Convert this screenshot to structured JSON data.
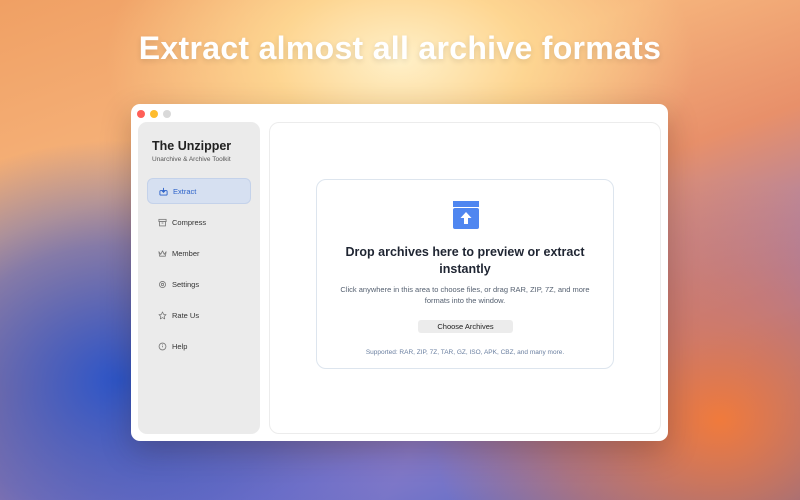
{
  "hero": {
    "title": "Extract almost all archive formats"
  },
  "app": {
    "title": "The Unzipper",
    "subtitle": "Unarchive & Archive Toolkit"
  },
  "sidebar": {
    "items": [
      {
        "label": "Extract",
        "icon": "extract-icon",
        "active": true
      },
      {
        "label": "Compress",
        "icon": "archive-box-icon",
        "active": false
      },
      {
        "label": "Member",
        "icon": "crown-icon",
        "active": false
      },
      {
        "label": "Settings",
        "icon": "gear-icon",
        "active": false
      },
      {
        "label": "Rate Us",
        "icon": "star-icon",
        "active": false
      },
      {
        "label": "Help",
        "icon": "help-icon",
        "active": false
      }
    ]
  },
  "dropzone": {
    "icon": "upload-box-icon",
    "title": "Drop archives here to preview or extract instantly",
    "description": "Click anywhere in this area to choose files, or drag RAR, ZIP, 7Z, and more formats into the window.",
    "button_label": "Choose Archives",
    "supported": "Supported: RAR, ZIP, 7Z, TAR, GZ, ISO, APK, CBZ, and many more."
  },
  "colors": {
    "accent": "#2c62c9",
    "icon_blue": "#4f86f0",
    "active_bg": "#d6e0f1"
  }
}
